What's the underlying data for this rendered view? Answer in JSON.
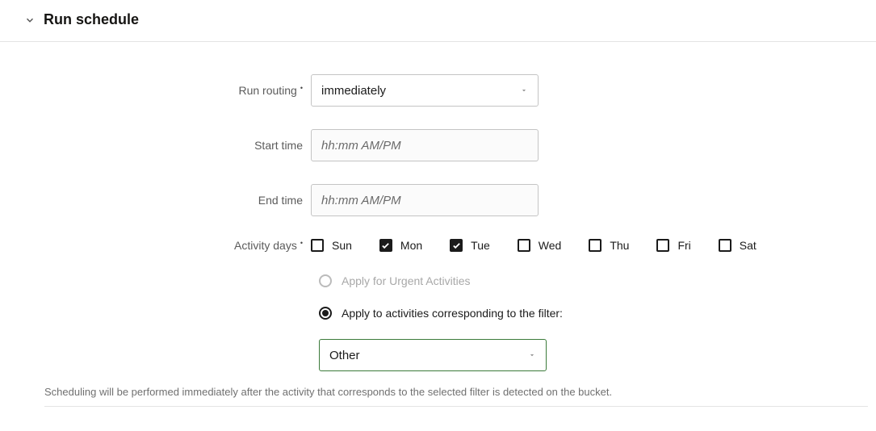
{
  "section": {
    "title": "Run schedule"
  },
  "labels": {
    "run_routing": "Run routing",
    "start_time": "Start time",
    "end_time": "End time",
    "activity_days": "Activity days"
  },
  "fields": {
    "run_routing_value": "immediately",
    "start_time_placeholder": "hh:mm AM/PM",
    "end_time_placeholder": "hh:mm AM/PM",
    "filter_value": "Other"
  },
  "days": [
    {
      "label": "Sun",
      "checked": false
    },
    {
      "label": "Mon",
      "checked": true
    },
    {
      "label": "Tue",
      "checked": true
    },
    {
      "label": "Wed",
      "checked": false
    },
    {
      "label": "Thu",
      "checked": false
    },
    {
      "label": "Fri",
      "checked": false
    },
    {
      "label": "Sat",
      "checked": false
    }
  ],
  "radios": {
    "urgent_label": "Apply for Urgent Activities",
    "filter_label": "Apply to activities corresponding to the filter:",
    "selected": "filter"
  },
  "help_text": "Scheduling will be performed immediately after the activity that corresponds to the selected filter is detected on the bucket."
}
